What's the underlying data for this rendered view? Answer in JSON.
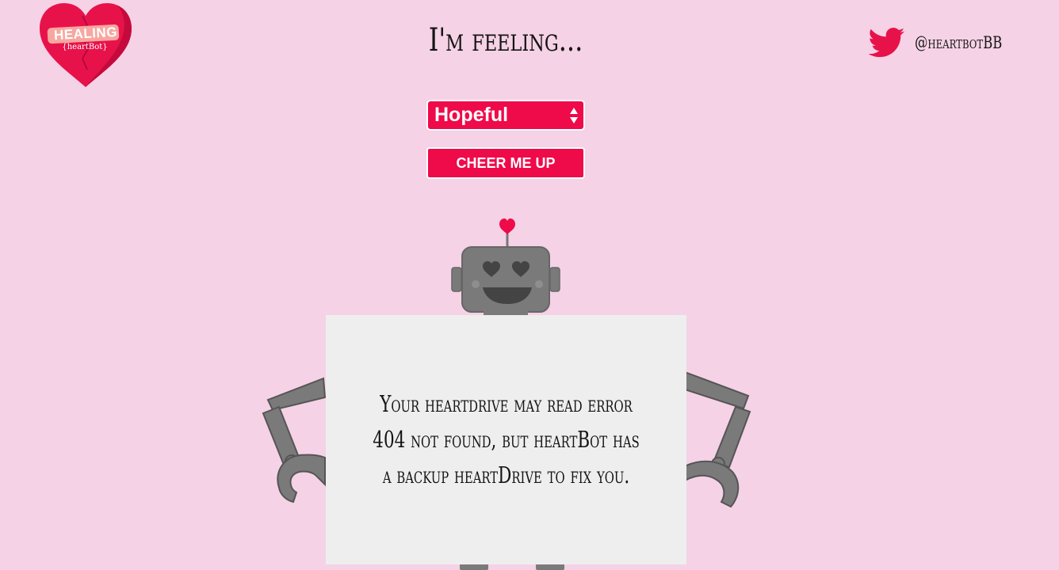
{
  "logo": {
    "title": "HEALING",
    "subtitle": "{heartBot}"
  },
  "header": {
    "title": "I'm feeling...",
    "twitter_handle": "@heartbotBB"
  },
  "form": {
    "mood_select_value": "Hopeful",
    "cheer_button_label": "CHEER ME UP"
  },
  "robot": {
    "sign_text": "Your heartdrive may read error 404 not found, but heartBot has a backup heartDrive to fix you."
  },
  "colors": {
    "background": "#f5d2e6",
    "accent": "#ef0a4a",
    "twitter_blue": "#e8124b",
    "robot_gray": "#7a7a7a"
  }
}
